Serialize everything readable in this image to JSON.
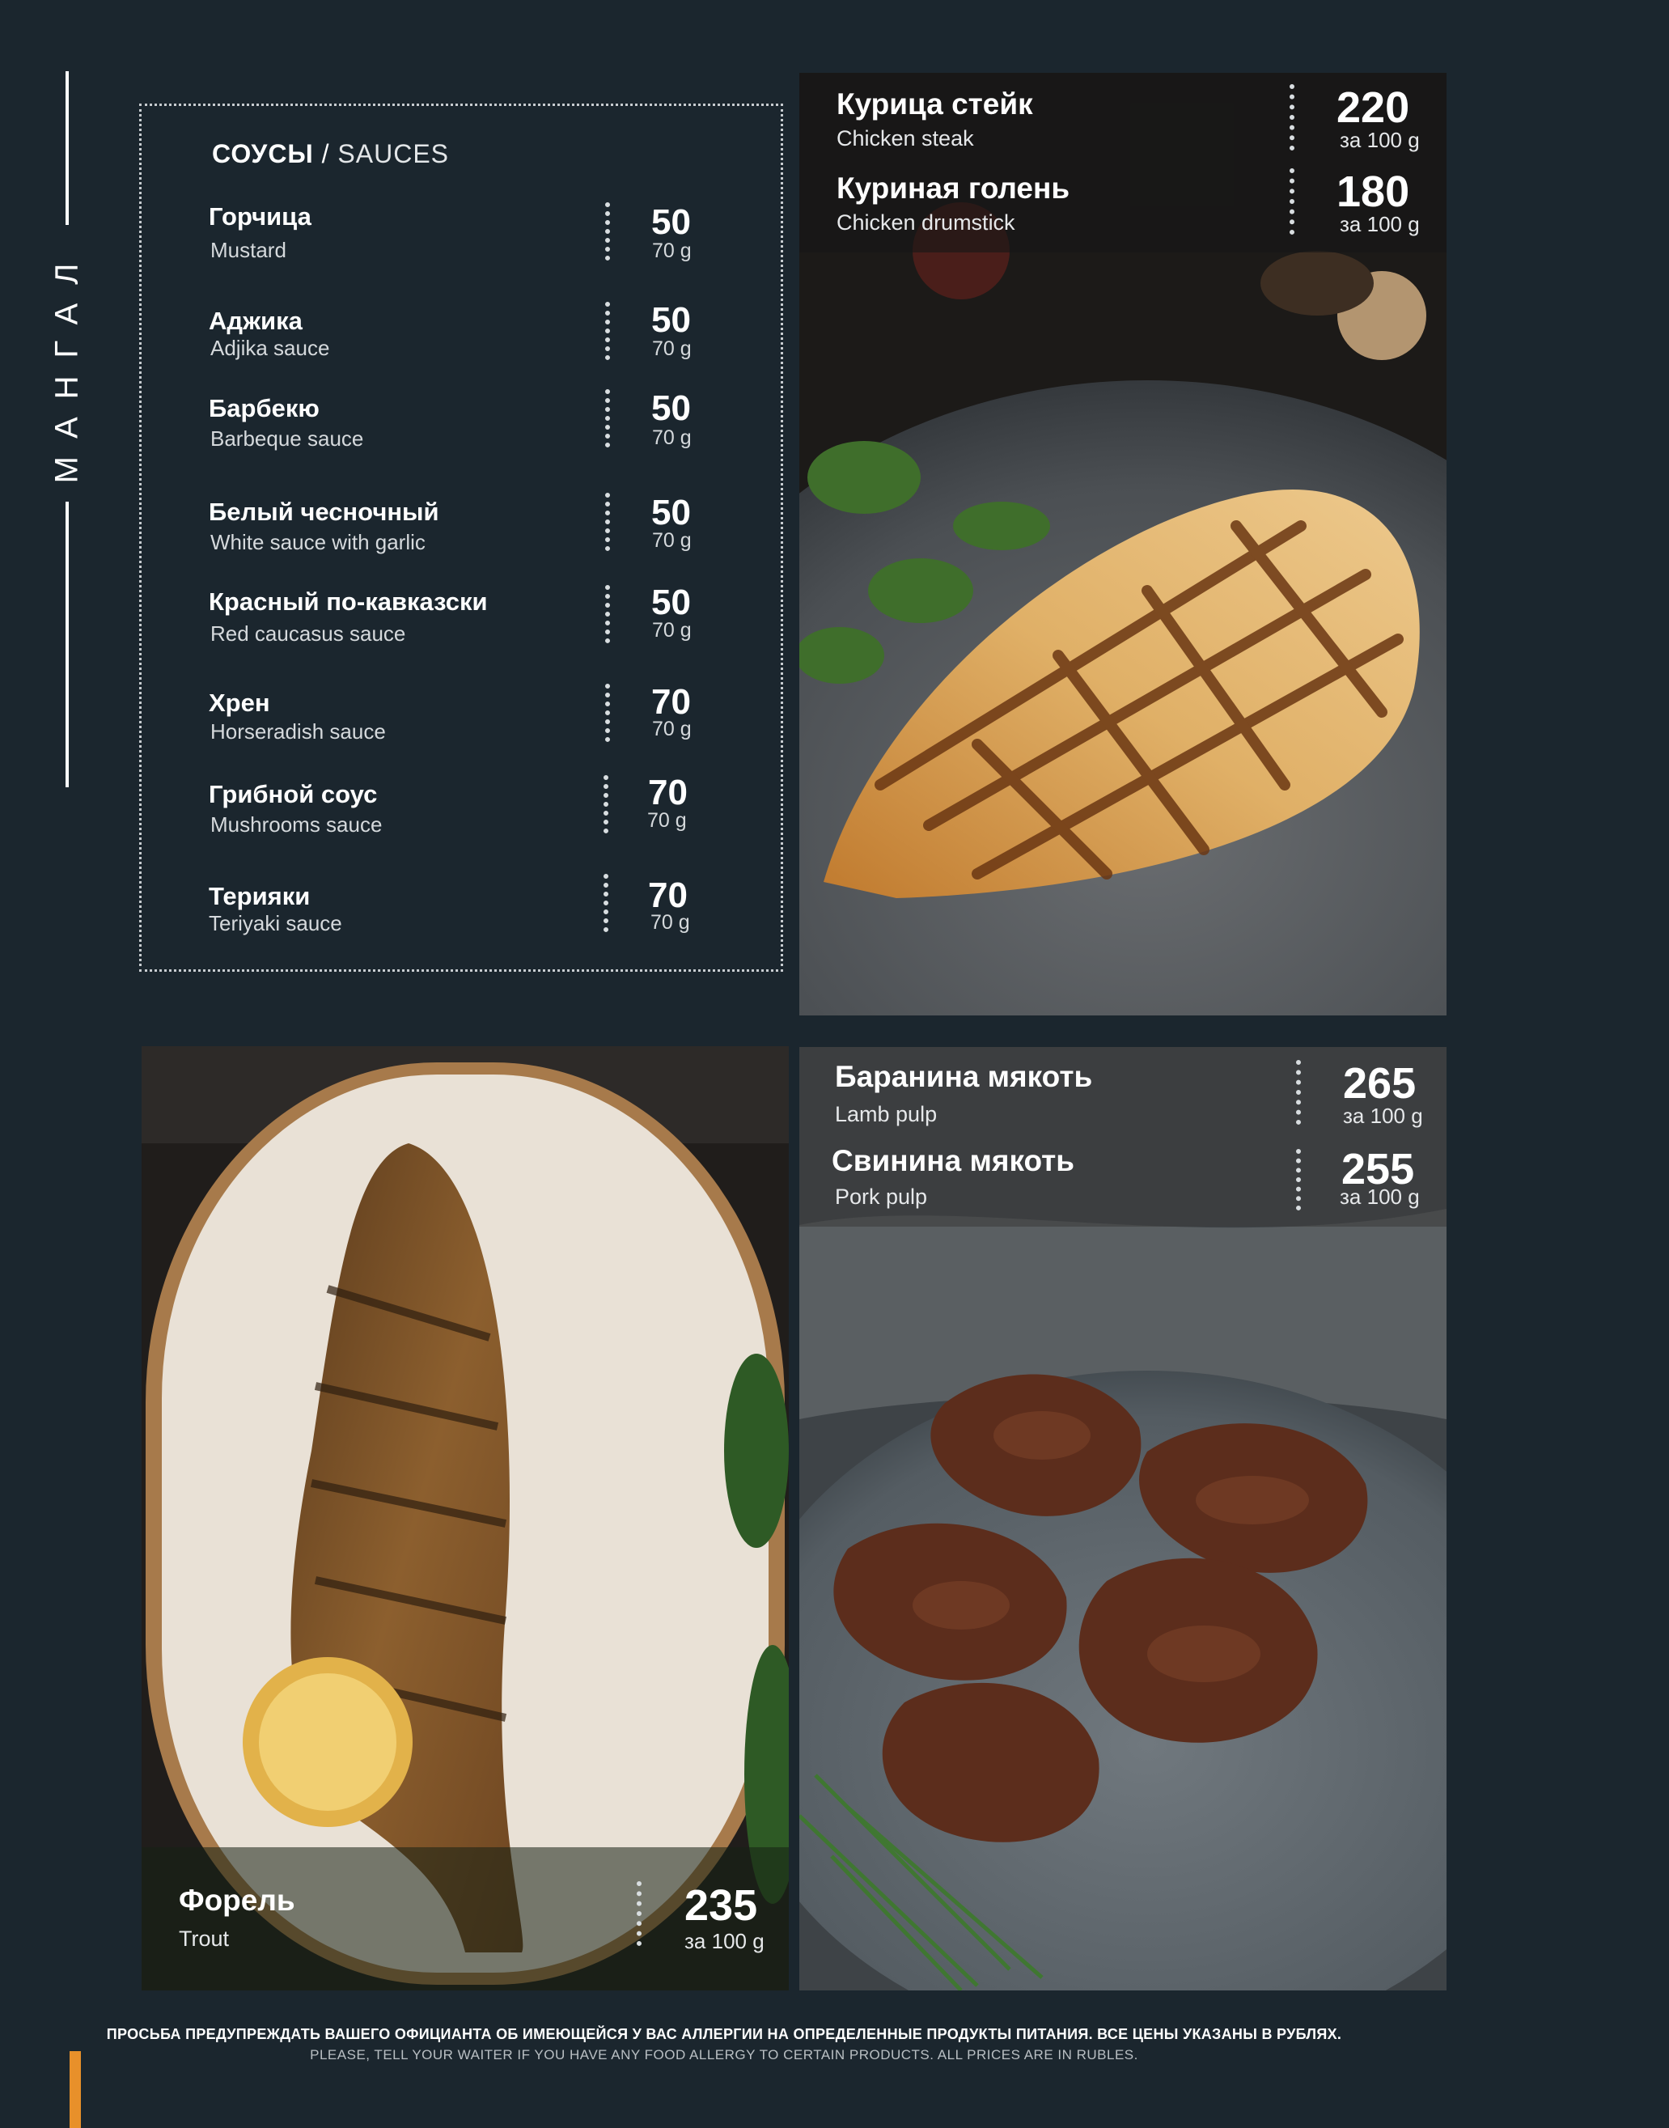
{
  "side_title": "МАНГАЛ",
  "sauces": {
    "heading_ru": "СОУСЫ",
    "heading_sep": " / ",
    "heading_en": "SAUCES",
    "items": [
      {
        "ru": "Горчица",
        "en": "Mustard",
        "price": "50",
        "unit": "70 g"
      },
      {
        "ru": "Аджика",
        "en": "Adjika sauce",
        "price": "50",
        "unit": "70 g"
      },
      {
        "ru": "Барбекю",
        "en": "Barbeque sauce",
        "price": "50",
        "unit": "70 g"
      },
      {
        "ru": "Белый чесночный",
        "en": "White sauce with garlic",
        "price": "50",
        "unit": "70 g"
      },
      {
        "ru": "Красный по-кавказски",
        "en": "Red caucasus sauce",
        "price": "50",
        "unit": "70 g"
      },
      {
        "ru": "Хрен",
        "en": "Horseradish sauce",
        "price": "70",
        "unit": "70 g"
      },
      {
        "ru": "Грибной соус",
        "en": "Mushrooms sauce",
        "price": "70",
        "unit": "70 g"
      },
      {
        "ru": "Терияки",
        "en": "Teriyaki sauce",
        "price": "70",
        "unit": "70 g"
      }
    ]
  },
  "chicken": {
    "items": [
      {
        "ru": "Курица стейк",
        "en": "Chicken steak",
        "price": "220",
        "unit": "за 100 g"
      },
      {
        "ru": "Куриная голень",
        "en": "Chicken drumstick",
        "price": "180",
        "unit": "за 100 g"
      }
    ]
  },
  "trout": {
    "ru": "Форель",
    "en": "Trout",
    "price": "235",
    "unit": "за 100 g"
  },
  "meat": {
    "items": [
      {
        "ru": "Баранина мякоть",
        "en": "Lamb pulp",
        "price": "265",
        "unit": "за 100 g"
      },
      {
        "ru": "Свинина мякоть",
        "en": "Pork pulp",
        "price": "255",
        "unit": "за 100 g"
      }
    ]
  },
  "footer": {
    "line1": "ПРОСЬБА ПРЕДУПРЕЖДАТЬ ВАШЕГО ОФИЦИАНТА ОБ ИМЕЮЩЕЙСЯ У ВАС АЛЛЕРГИИ НА ОПРЕДЕЛЕННЫЕ ПРОДУКТЫ ПИТАНИЯ. ВСЕ ЦЕНЫ УКАЗАНЫ В РУБЛЯХ.",
    "line2": "PLEASE, TELL YOUR WAITER IF YOU HAVE ANY FOOD ALLERGY TO CERTAIN PRODUCTS. ALL PRICES ARE IN RUBLES."
  },
  "colors": {
    "background": "#1b262e",
    "accent": "#e8902a"
  }
}
